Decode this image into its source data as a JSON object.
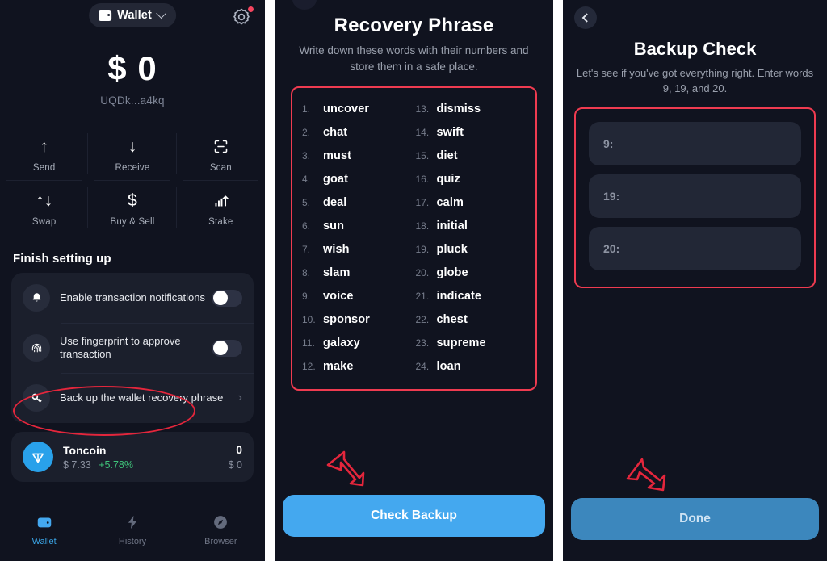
{
  "wallet_panel": {
    "chip": {
      "label": "Wallet",
      "icon": "wallet-icon",
      "chevron": "chevron-down-icon"
    },
    "settings_icon": "gear-icon",
    "has_settings_badge": true,
    "balance": {
      "amount": "$ 0",
      "address": "UQDk...a4kq"
    },
    "actions": [
      {
        "label": "Send",
        "glyph": "↑",
        "icon": "arrow-up-icon"
      },
      {
        "label": "Receive",
        "glyph": "↓",
        "icon": "arrow-down-icon"
      },
      {
        "label": "Scan",
        "glyph": "",
        "icon": "scan-icon"
      },
      {
        "label": "Swap",
        "glyph": "↑↓",
        "icon": "swap-icon"
      },
      {
        "label": "Buy & Sell",
        "glyph": "$",
        "icon": "dollar-icon"
      },
      {
        "label": "Stake",
        "glyph": "",
        "icon": "stake-chart-icon"
      }
    ],
    "section_title": "Finish setting up",
    "setup_rows": [
      {
        "text": "Enable transaction notifications",
        "icon": "bell-icon",
        "control": "toggle",
        "on": false
      },
      {
        "text": "Use fingerprint to approve transaction",
        "icon": "fingerprint-icon",
        "control": "toggle",
        "on": false
      },
      {
        "text": "Back up the wallet recovery phrase",
        "icon": "key-icon",
        "control": "chevron",
        "highlighted": true
      }
    ],
    "asset": {
      "name": "Toncoin",
      "price": "$ 7.33",
      "change": "+5.78%",
      "quantity": "0",
      "fiat": "$ 0",
      "logo": "toncoin-icon"
    },
    "tabs": [
      {
        "label": "Wallet",
        "icon": "wallet-tab-icon",
        "active": true
      },
      {
        "label": "History",
        "icon": "history-tab-icon",
        "active": false
      },
      {
        "label": "Browser",
        "icon": "browser-tab-icon",
        "active": false
      }
    ]
  },
  "phrase_panel": {
    "title": "Recovery Phrase",
    "subtitle": "Write down these words with their numbers and store them in a safe place.",
    "words": [
      {
        "n": "1.",
        "w": "uncover"
      },
      {
        "n": "2.",
        "w": "chat"
      },
      {
        "n": "3.",
        "w": "must"
      },
      {
        "n": "4.",
        "w": "goat"
      },
      {
        "n": "5.",
        "w": "deal"
      },
      {
        "n": "6.",
        "w": "sun"
      },
      {
        "n": "7.",
        "w": "wish"
      },
      {
        "n": "8.",
        "w": "slam"
      },
      {
        "n": "9.",
        "w": "voice"
      },
      {
        "n": "10.",
        "w": "sponsor"
      },
      {
        "n": "11.",
        "w": "galaxy"
      },
      {
        "n": "12.",
        "w": "make"
      },
      {
        "n": "13.",
        "w": "dismiss"
      },
      {
        "n": "14.",
        "w": "swift"
      },
      {
        "n": "15.",
        "w": "diet"
      },
      {
        "n": "16.",
        "w": "quiz"
      },
      {
        "n": "17.",
        "w": "calm"
      },
      {
        "n": "18.",
        "w": "initial"
      },
      {
        "n": "19.",
        "w": "pluck"
      },
      {
        "n": "20.",
        "w": "globe"
      },
      {
        "n": "21.",
        "w": "indicate"
      },
      {
        "n": "22.",
        "w": "chest"
      },
      {
        "n": "23.",
        "w": "supreme"
      },
      {
        "n": "24.",
        "w": "loan"
      }
    ],
    "cta_label": "Check Backup",
    "annotation_arrow": "red-arrow-pointing-to-check-backup"
  },
  "backup_panel": {
    "back_icon": "chevron-left-icon",
    "title": "Backup Check",
    "subtitle": "Let's see if you've got everything right. Enter words 9, 19, and 20.",
    "fields": [
      {
        "label": "9:",
        "value": "",
        "placeholder": ""
      },
      {
        "label": "19:",
        "value": "",
        "placeholder": ""
      },
      {
        "label": "20:",
        "value": "",
        "placeholder": ""
      }
    ],
    "cta_label": "Done",
    "cta_disabled": true,
    "annotation_arrow": "red-arrow-pointing-to-done"
  },
  "colors": {
    "panel_bg": "#10131f",
    "card_bg": "#1b1f2c",
    "accent_blue": "#44a8ef",
    "disabled_blue": "#3c87bd",
    "highlight_red": "#ef3b50",
    "positive_green": "#3fc37a",
    "muted_text": "#9aa0ad"
  }
}
